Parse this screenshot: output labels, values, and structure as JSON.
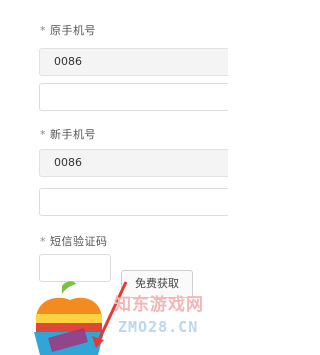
{
  "form": {
    "required_mark": "*",
    "old_phone": {
      "label": "原手机号",
      "prefix": "0086",
      "value": ""
    },
    "new_phone": {
      "label": "新手机号",
      "prefix": "0086",
      "value": ""
    },
    "sms_code": {
      "label": "短信验证码",
      "value": "",
      "button_label": "免费获取"
    }
  },
  "watermark": {
    "site_name": "知东游戏网",
    "site_url": "ZMO28.CN",
    "colors": {
      "text": "#f3b6b6",
      "url": "#b9d7f0",
      "arrow": "#e53935"
    }
  }
}
